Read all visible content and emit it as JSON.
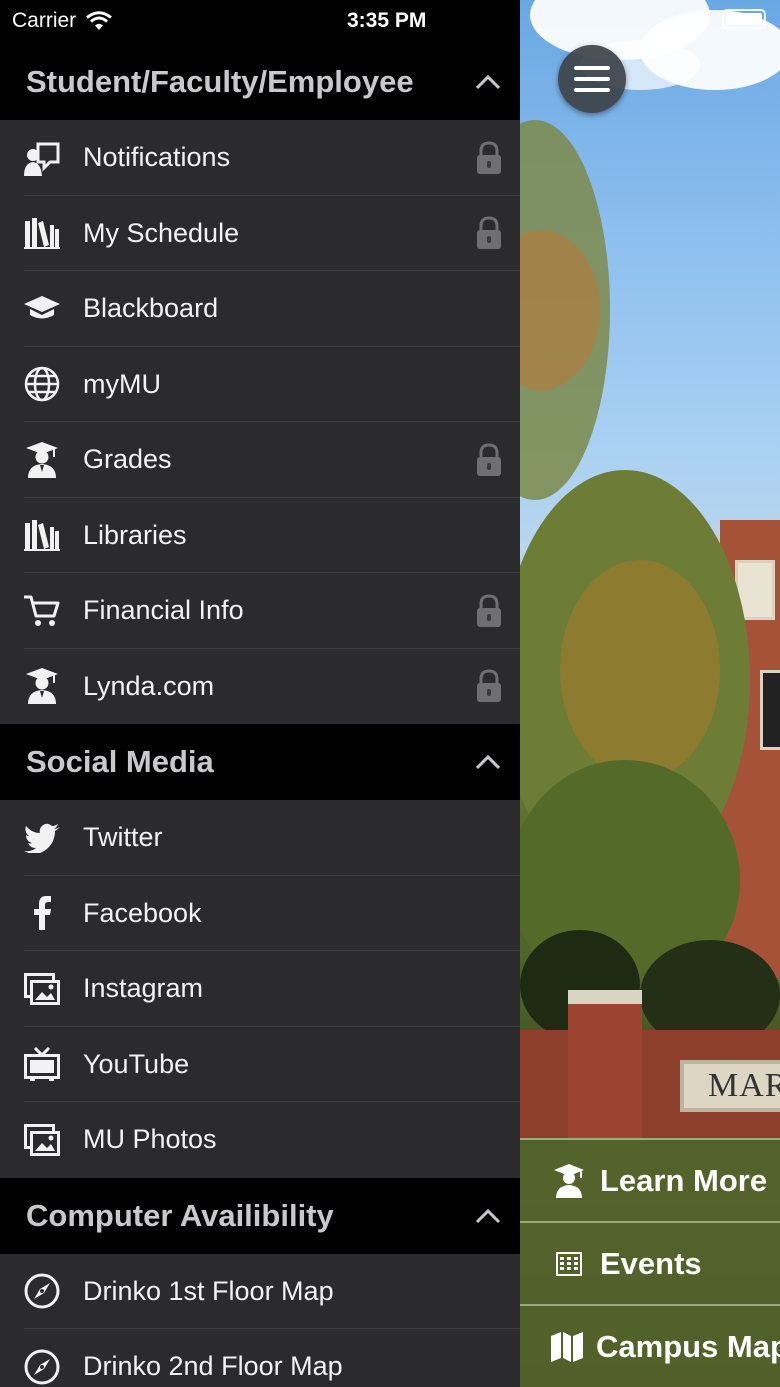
{
  "status_bar": {
    "carrier": "Carrier",
    "time": "3:35 PM"
  },
  "sections": [
    {
      "title": "Student/Faculty/Employee",
      "items": [
        {
          "label": "Notifications",
          "icon": "notification-icon",
          "locked": true
        },
        {
          "label": "My Schedule",
          "icon": "books-icon",
          "locked": true
        },
        {
          "label": "Blackboard",
          "icon": "graduation-cap-icon",
          "locked": false
        },
        {
          "label": "myMU",
          "icon": "globe-icon",
          "locked": false
        },
        {
          "label": "Grades",
          "icon": "student-icon",
          "locked": true
        },
        {
          "label": "Libraries",
          "icon": "books-icon",
          "locked": false
        },
        {
          "label": "Financial Info",
          "icon": "cart-icon",
          "locked": true
        },
        {
          "label": "Lynda.com",
          "icon": "student-icon",
          "locked": true
        }
      ]
    },
    {
      "title": "Social Media",
      "items": [
        {
          "label": "Twitter",
          "icon": "twitter-icon",
          "locked": false
        },
        {
          "label": "Facebook",
          "icon": "facebook-icon",
          "locked": false
        },
        {
          "label": "Instagram",
          "icon": "photos-icon",
          "locked": false
        },
        {
          "label": "YouTube",
          "icon": "tv-icon",
          "locked": false
        },
        {
          "label": "MU Photos",
          "icon": "photos-icon",
          "locked": false
        }
      ]
    },
    {
      "title": "Computer Availibility",
      "items": [
        {
          "label": "Drinko 1st Floor Map",
          "icon": "compass-icon",
          "locked": false
        },
        {
          "label": "Drinko 2nd Floor Map",
          "icon": "compass-icon",
          "locked": false
        }
      ]
    }
  ],
  "background": {
    "sign_text": "MAR",
    "bottom_menu": [
      {
        "label": "Learn More",
        "icon": "student-icon"
      },
      {
        "label": "Events",
        "icon": "calendar-icon"
      },
      {
        "label": "Campus Map",
        "icon": "map-icon"
      }
    ]
  }
}
